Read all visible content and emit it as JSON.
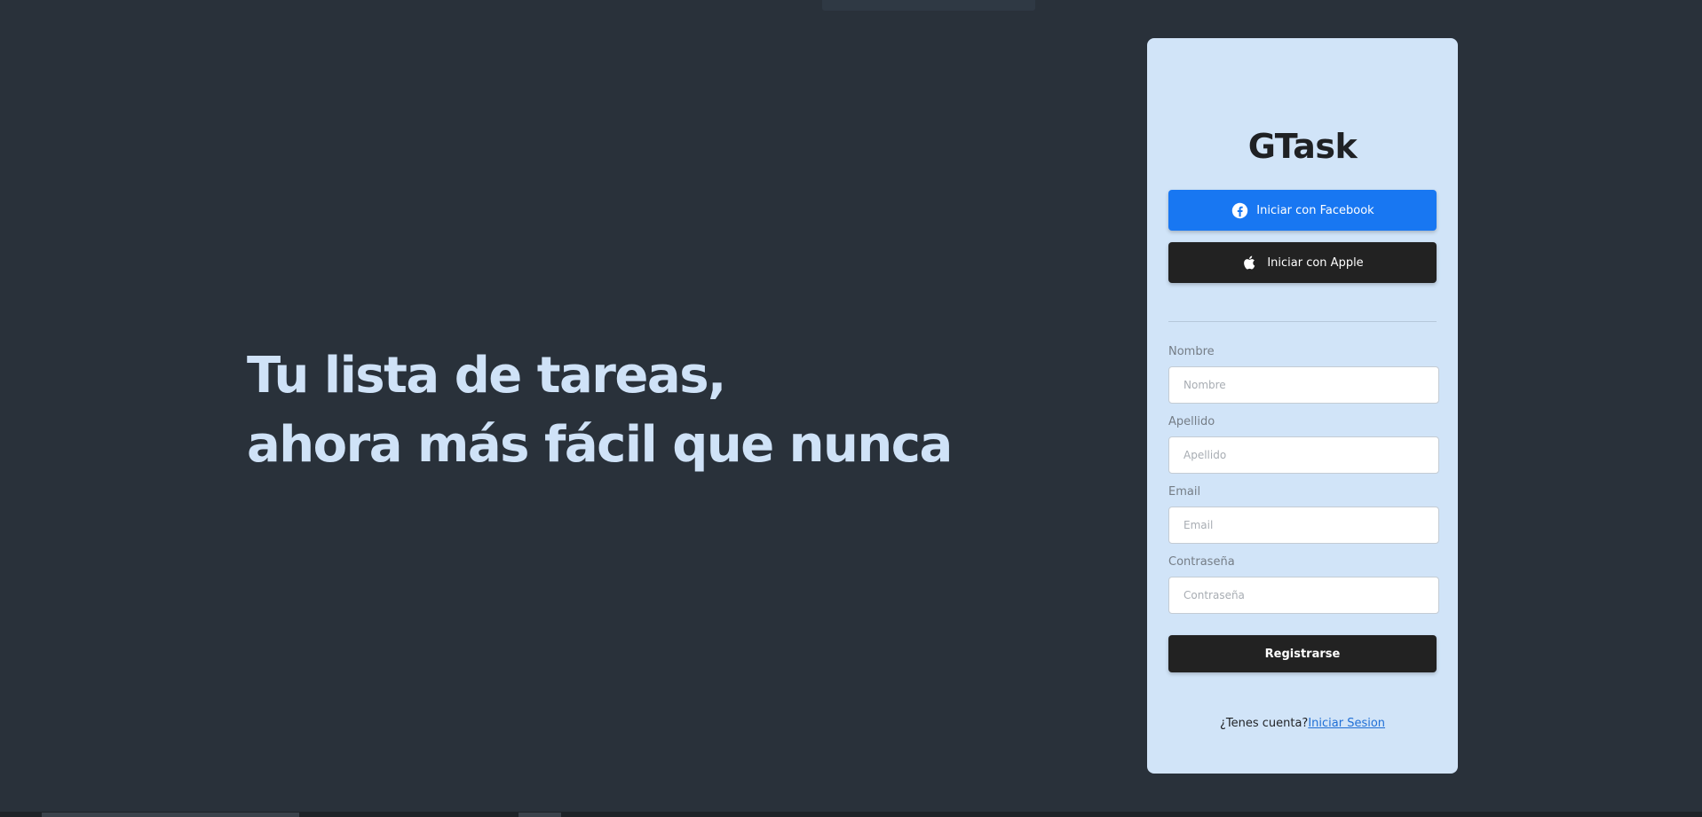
{
  "hero": {
    "line1": "Tu lista de tareas,",
    "line2": "ahora más fácil que nunca"
  },
  "card": {
    "brand": "GTask",
    "facebook_button": "Iniciar con Facebook",
    "apple_button": "Iniciar con Apple",
    "fields": [
      {
        "label": "Nombre",
        "placeholder": "Nombre",
        "value": ""
      },
      {
        "label": "Apellido",
        "placeholder": "Apellido",
        "value": ""
      },
      {
        "label": "Email",
        "placeholder": "Email",
        "value": ""
      },
      {
        "label": "Contraseña",
        "placeholder": "Contraseña",
        "value": ""
      }
    ],
    "register_button": "Registrarse",
    "login_prompt": "¿Tenes cuenta?",
    "login_link": "Iniciar Sesion"
  },
  "icons": {
    "facebook": "facebook-icon",
    "apple": "apple-icon"
  },
  "colors": {
    "background": "#29313a",
    "hero_text": "#cfe2f7",
    "card_background": "#d1e4f8",
    "facebook_blue": "#1877f2",
    "dark_button": "#222222",
    "link": "#1f6fd6"
  }
}
